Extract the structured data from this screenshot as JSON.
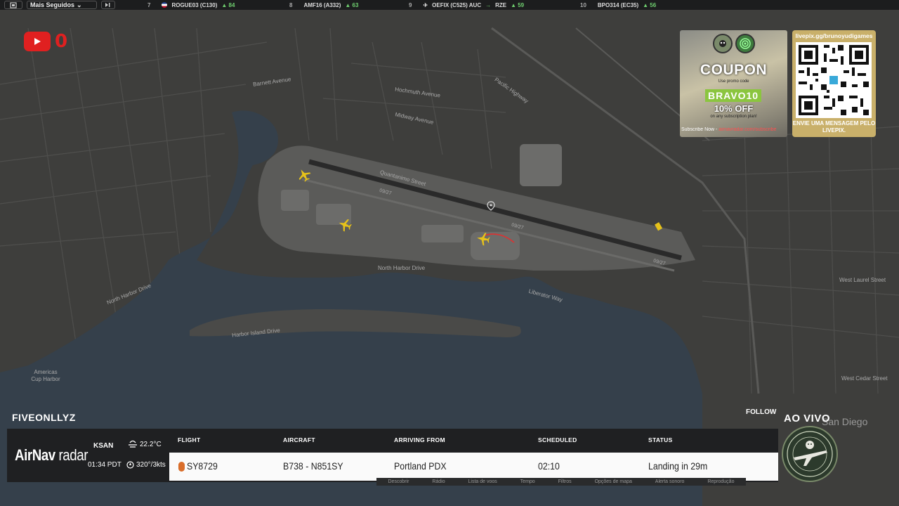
{
  "topbar": {
    "menu_label": "Mais Seguidos",
    "items": [
      {
        "rank": "7",
        "callsign": "ROGUE03 (C130)",
        "score": "84"
      },
      {
        "rank": "8",
        "callsign": "AMF16 (A332)",
        "score": "63"
      },
      {
        "rank": "9",
        "callsign": "OEFIX (C525) AUC",
        "dest": "RZE",
        "score": "59"
      },
      {
        "rank": "10",
        "callsign": "BPO314 (EC35)",
        "score": "56"
      }
    ]
  },
  "youtube": {
    "count": "0"
  },
  "map": {
    "labels": {
      "americas_cup_harbor": "Americas Cup Harbor",
      "north_harbor_drive": "North Harbor Drive",
      "north_harbor_drive_2": "North Harbor Drive",
      "harbor_island_drive": "Harbor Island Drive",
      "midway_avenue": "Midway Avenue",
      "hochmuth_avenue": "Hochmuth Avenue",
      "pacific_highway": "Pacific Highway",
      "quantanimo_street": "Quantanimo Street",
      "liberator_way": "Liberator Way",
      "rwy_1": "09/27",
      "rwy_2": "09/27",
      "rwy_3": "09/27",
      "west_cedar_street": "West Cedar Street",
      "west_laurel_street": "West Laurel Street",
      "barnett_avenue": "Barnett Avenue"
    }
  },
  "coupon": {
    "title": "COUPON",
    "subtitle": "Use promo code",
    "code": "BRAVO10",
    "discount": "10% OFF",
    "description": "on any subscription plan!",
    "footer_prefix": "Subscribe Now - ",
    "footer_link": "airnavradar.com/subscribe"
  },
  "livepix": {
    "url": "livepix.gg/brunoyudigames",
    "message": "ENVIE UMA MENSAGEM PELO LIVEPIX."
  },
  "stream": {
    "streamer": "FIVEONLLYZ",
    "follow": "FOLLOW",
    "live": "AO VIVO",
    "city": "San Diego"
  },
  "panel": {
    "brand_part1": "AirNav",
    "brand_part2": " radar",
    "airport": "KSAN",
    "local_time": "01:34 PDT",
    "temperature": "22.2°C",
    "wind": "320°/3kts",
    "headers": {
      "flight": "FLIGHT",
      "aircraft": "AIRCRAFT",
      "arriving_from": "ARRIVING FROM",
      "scheduled": "SCHEDULED",
      "status": "STATUS"
    },
    "row": {
      "flight": "SY8729",
      "aircraft": "B738 - N851SY",
      "arriving_from": "Portland PDX",
      "scheduled": "02:10",
      "status": "Landing in 29m"
    }
  },
  "under_labels": [
    "Descobrir",
    "Rádio",
    "Lista de voos",
    "Tempo",
    "Filtros",
    "Opções de mapa",
    "Alerta sonoro",
    "Reprodução"
  ]
}
